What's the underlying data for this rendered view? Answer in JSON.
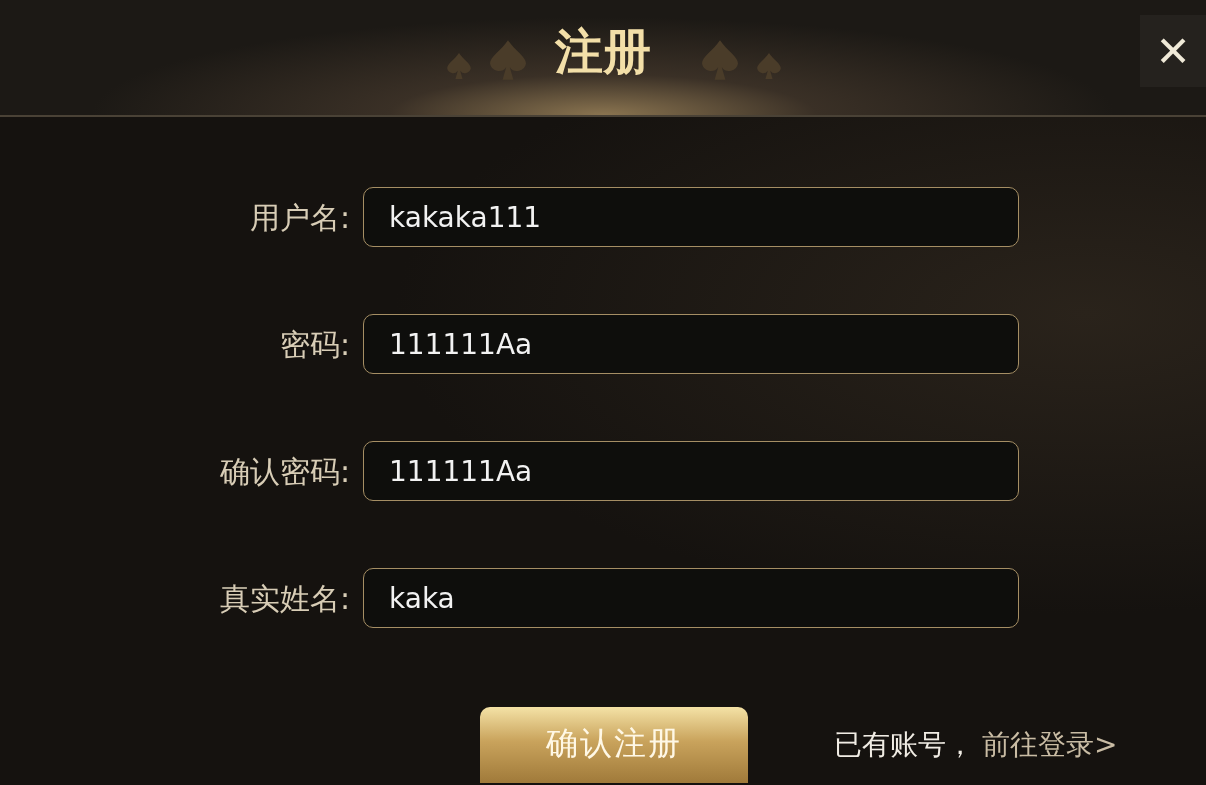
{
  "header": {
    "title": "注册",
    "close": "✕"
  },
  "fields": [
    {
      "label": "用户名:",
      "value": "kakaka111"
    },
    {
      "label": "密码:",
      "value": "111111Aa"
    },
    {
      "label": "确认密码:",
      "value": "111111Aa"
    },
    {
      "label": "真实姓名:",
      "value": "kaka"
    }
  ],
  "submit": "确认注册",
  "login_prompt": "已有账号，",
  "login_link": "前往登录>"
}
